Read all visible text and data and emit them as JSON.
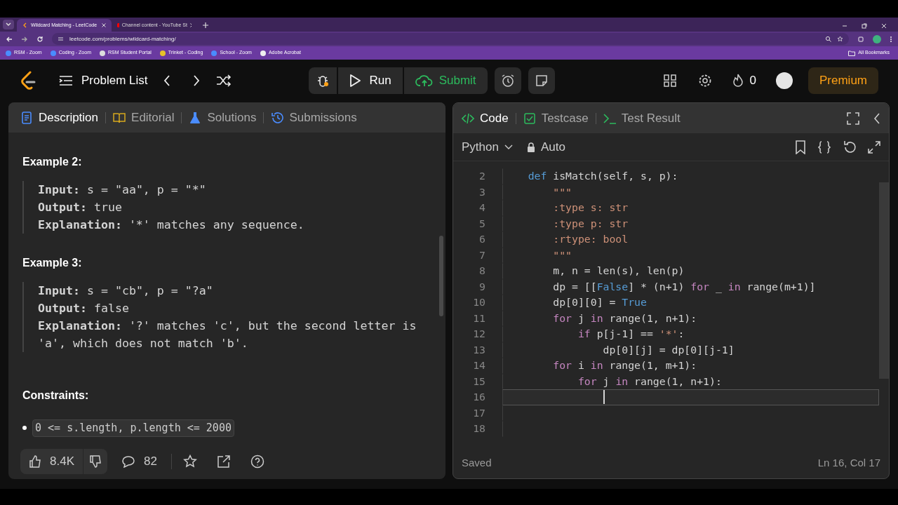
{
  "browser": {
    "tabs": [
      {
        "title": "Wildcard Matching - LeetCode",
        "selected": true
      },
      {
        "title": "Channel content - YouTube St",
        "selected": false
      }
    ],
    "url": "leetcode.com/problems/wildcard-matching/",
    "bookmarks": [
      "RSM - Zoom",
      "Coding - Zoom",
      "RSM Student Portal",
      "Trinket - Coding",
      "School - Zoom",
      "Adobe Acrobat"
    ],
    "all_bookmarks": "All Bookmarks"
  },
  "header": {
    "problem_list": "Problem List",
    "run": "Run",
    "submit": "Submit",
    "streak": "0",
    "premium": "Premium"
  },
  "left_panel": {
    "tabs": [
      {
        "label": "Description",
        "selected": true
      },
      {
        "label": "Editorial",
        "selected": false
      },
      {
        "label": "Solutions",
        "selected": false
      },
      {
        "label": "Submissions",
        "selected": false
      }
    ],
    "examples": [
      {
        "title": "Example 2:",
        "lines": [
          "**Input:** s = \"aa\", p = \"*\"",
          "**Output:** true",
          "**Explanation:** '*' matches any sequence."
        ]
      },
      {
        "title": "Example 3:",
        "lines": [
          "**Input:** s = \"cb\", p = \"?a\"",
          "**Output:** false",
          "**Explanation:** '?' matches 'c', but the second letter is 'a', which does not match 'b'."
        ]
      }
    ],
    "constraints_title": "Constraints:",
    "constraints": [
      "0 <= s.length, p.length <= 2000"
    ],
    "likes": "8.4K",
    "comments": "82"
  },
  "right_panel": {
    "tabs": [
      {
        "label": "Code",
        "selected": true
      },
      {
        "label": "Testcase",
        "selected": false
      },
      {
        "label": "Test Result",
        "selected": false
      }
    ],
    "language": "Python",
    "mode": "Auto",
    "lines": [
      {
        "number": "2",
        "active": false,
        "tokens": [
          {
            "kind": "keyword",
            "text": "    def"
          },
          {
            "kind": "plain",
            "text": " isMatch(self, s, p):"
          }
        ]
      },
      {
        "number": "3",
        "active": false,
        "tokens": [
          {
            "kind": "string",
            "text": "        \"\"\""
          }
        ]
      },
      {
        "number": "4",
        "active": false,
        "tokens": [
          {
            "kind": "string",
            "text": "        :type s: str"
          }
        ]
      },
      {
        "number": "5",
        "active": false,
        "tokens": [
          {
            "kind": "string",
            "text": "        :type p: str"
          }
        ]
      },
      {
        "number": "6",
        "active": false,
        "tokens": [
          {
            "kind": "string",
            "text": "        :rtype: bool"
          }
        ]
      },
      {
        "number": "7",
        "active": false,
        "tokens": [
          {
            "kind": "string",
            "text": "        \"\"\""
          }
        ]
      },
      {
        "number": "8",
        "active": false,
        "tokens": [
          {
            "kind": "plain",
            "text": "        m, n = len(s), len(p)"
          }
        ]
      },
      {
        "number": "9",
        "active": false,
        "tokens": [
          {
            "kind": "plain",
            "text": "        dp = [["
          },
          {
            "kind": "constant",
            "text": "False"
          },
          {
            "kind": "plain",
            "text": "] * (n+1) "
          },
          {
            "kind": "control",
            "text": "for"
          },
          {
            "kind": "plain",
            "text": " _ "
          },
          {
            "kind": "control",
            "text": "in"
          },
          {
            "kind": "plain",
            "text": " range(m+1)]"
          }
        ]
      },
      {
        "number": "10",
        "active": false,
        "tokens": [
          {
            "kind": "plain",
            "text": "        dp[0][0] = "
          },
          {
            "kind": "constant",
            "text": "True"
          }
        ]
      },
      {
        "number": "11",
        "active": false,
        "tokens": [
          {
            "kind": "control",
            "text": "        for"
          },
          {
            "kind": "plain",
            "text": " j "
          },
          {
            "kind": "control",
            "text": "in"
          },
          {
            "kind": "plain",
            "text": " range(1, n+1):"
          }
        ]
      },
      {
        "number": "12",
        "active": false,
        "tokens": [
          {
            "kind": "control",
            "text": "            if"
          },
          {
            "kind": "plain",
            "text": " p[j-1] == "
          },
          {
            "kind": "string",
            "text": "'*'"
          },
          {
            "kind": "plain",
            "text": ":"
          }
        ]
      },
      {
        "number": "13",
        "active": false,
        "tokens": [
          {
            "kind": "plain",
            "text": "                dp[0][j] = dp[0][j-1]"
          }
        ]
      },
      {
        "number": "14",
        "active": false,
        "tokens": [
          {
            "kind": "control",
            "text": "        for"
          },
          {
            "kind": "plain",
            "text": " i "
          },
          {
            "kind": "control",
            "text": "in"
          },
          {
            "kind": "plain",
            "text": " range(1, m+1):"
          }
        ]
      },
      {
        "number": "15",
        "active": false,
        "tokens": [
          {
            "kind": "control",
            "text": "            for"
          },
          {
            "kind": "plain",
            "text": " j "
          },
          {
            "kind": "control",
            "text": "in"
          },
          {
            "kind": "plain",
            "text": " range(1, n+1):"
          }
        ]
      },
      {
        "number": "16",
        "active": true
      },
      {
        "number": "17",
        "active": false
      },
      {
        "number": "18",
        "active": false
      }
    ],
    "status": "Saved",
    "position": "Ln 16, Col 17"
  }
}
